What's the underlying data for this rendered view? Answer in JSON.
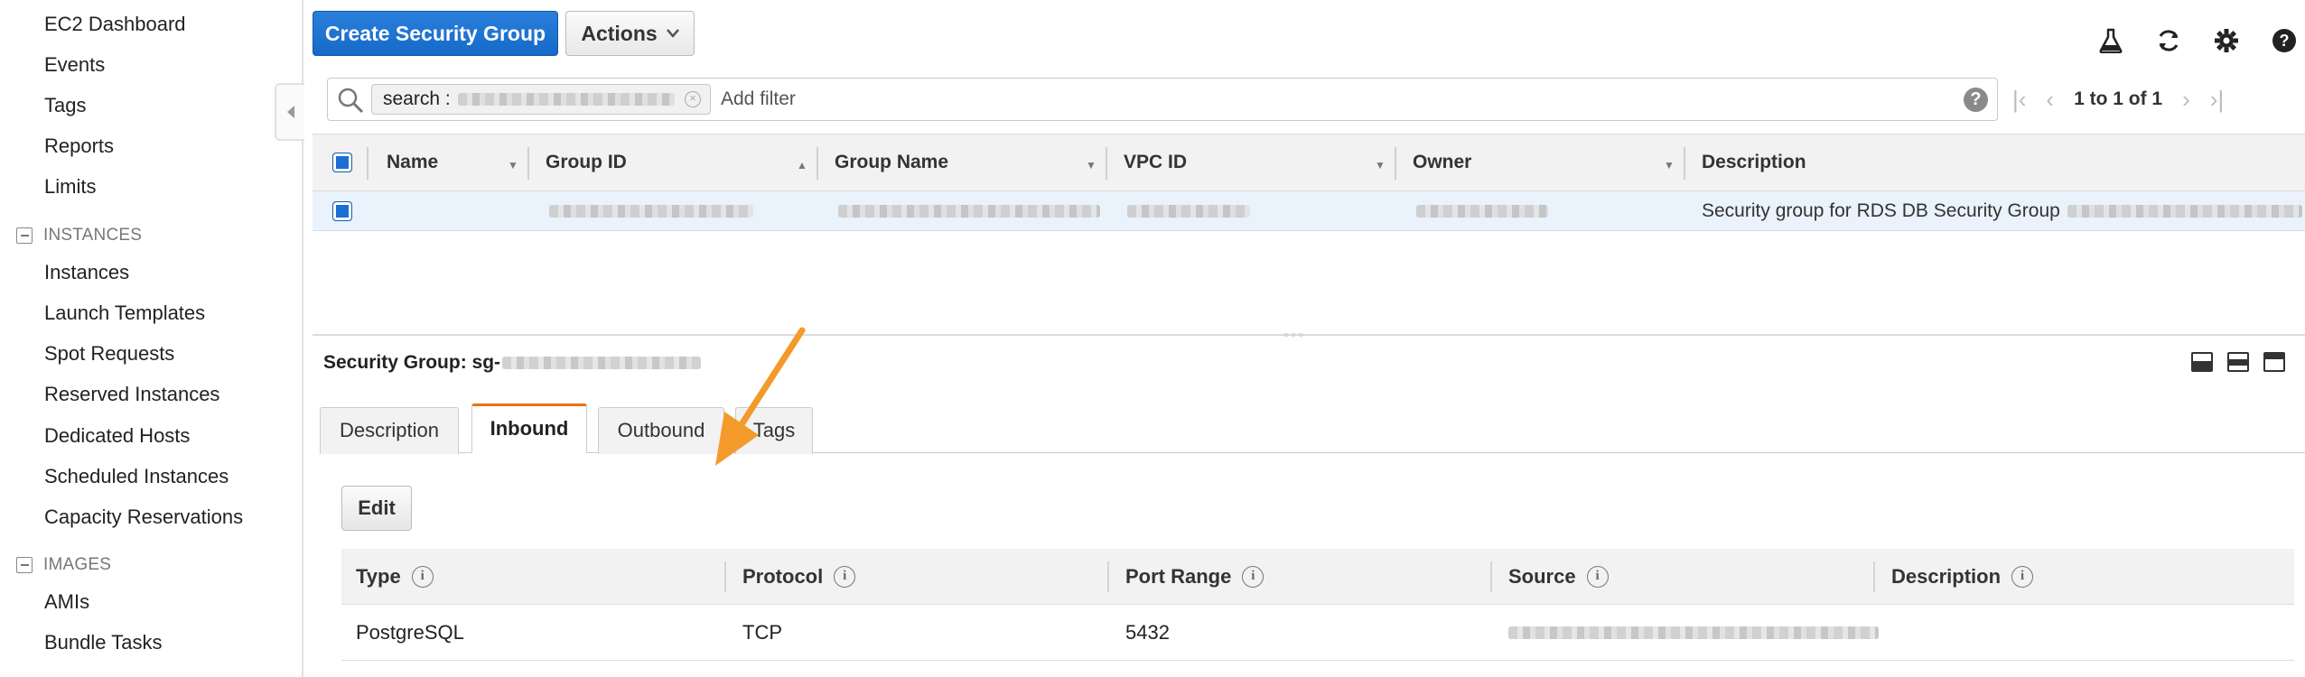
{
  "sidebar": {
    "items_top": [
      "EC2 Dashboard",
      "Events",
      "Tags",
      "Reports",
      "Limits"
    ],
    "section_instances": "INSTANCES",
    "items_instances": [
      "Instances",
      "Launch Templates",
      "Spot Requests",
      "Reserved Instances",
      "Dedicated Hosts",
      "Scheduled Instances",
      "Capacity Reservations"
    ],
    "section_images": "IMAGES",
    "items_images": [
      "AMIs",
      "Bundle Tasks"
    ]
  },
  "toolbar": {
    "create_label": "Create Security Group",
    "actions_label": "Actions"
  },
  "filter": {
    "token_label": "search :",
    "placeholder": "Add filter"
  },
  "pager": {
    "text": "1 to 1 of 1"
  },
  "grid": {
    "columns": [
      "Name",
      "Group ID",
      "Group Name",
      "VPC ID",
      "Owner",
      "Description"
    ],
    "row": {
      "description": "Security group for RDS DB Security Group"
    }
  },
  "details": {
    "title_prefix": "Security Group: sg-",
    "tabs": [
      "Description",
      "Inbound",
      "Outbound",
      "Tags"
    ],
    "active_tab": "Inbound",
    "edit_label": "Edit",
    "rules_columns": [
      "Type",
      "Protocol",
      "Port Range",
      "Source",
      "Description"
    ],
    "rules": [
      {
        "type": "PostgreSQL",
        "protocol": "TCP",
        "port_range": "5432"
      }
    ]
  },
  "colors": {
    "primary": "#1a6fd0",
    "accent_tab": "#ec7211",
    "annotation_arrow": "#f39a2b",
    "row_selected": "#eaf2fb"
  }
}
